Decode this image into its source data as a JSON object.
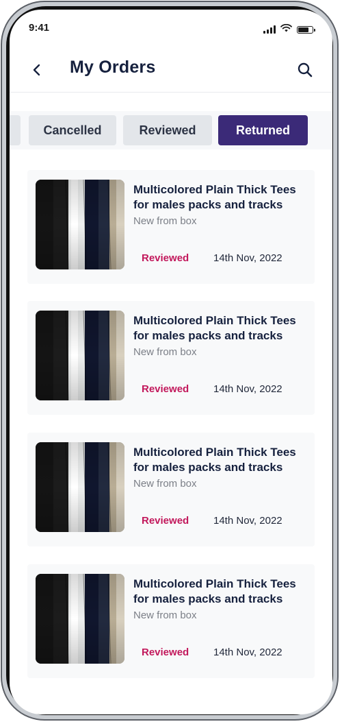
{
  "status_bar": {
    "time": "9:41"
  },
  "header": {
    "title": "My Orders"
  },
  "tabs": [
    {
      "label": ""
    },
    {
      "label": "Cancelled"
    },
    {
      "label": "Reviewed"
    },
    {
      "label": "Returned",
      "active": true
    }
  ],
  "orders": [
    {
      "title": "Multicolored Plain Thick Tees for males packs and tracks",
      "subtitle": "New from box",
      "status": "Reviewed",
      "date": "14th Nov, 2022"
    },
    {
      "title": "Multicolored Plain Thick Tees for males packs and tracks",
      "subtitle": "New from box",
      "status": "Reviewed",
      "date": "14th Nov, 2022"
    },
    {
      "title": "Multicolored Plain Thick Tees for males packs and tracks",
      "subtitle": "New from box",
      "status": "Reviewed",
      "date": "14th Nov, 2022"
    },
    {
      "title": "Multicolored Plain Thick Tees for males packs and tracks",
      "subtitle": "New from box",
      "status": "Reviewed",
      "date": "14th Nov, 2022"
    }
  ],
  "colors": {
    "accent": "#3b2a78",
    "status_reviewed": "#c2185b",
    "title_text": "#16213e"
  },
  "icons": {
    "back": "chevron-left-icon",
    "search": "search-icon",
    "signal": "cellular-signal-icon",
    "wifi": "wifi-icon",
    "battery": "battery-icon"
  }
}
